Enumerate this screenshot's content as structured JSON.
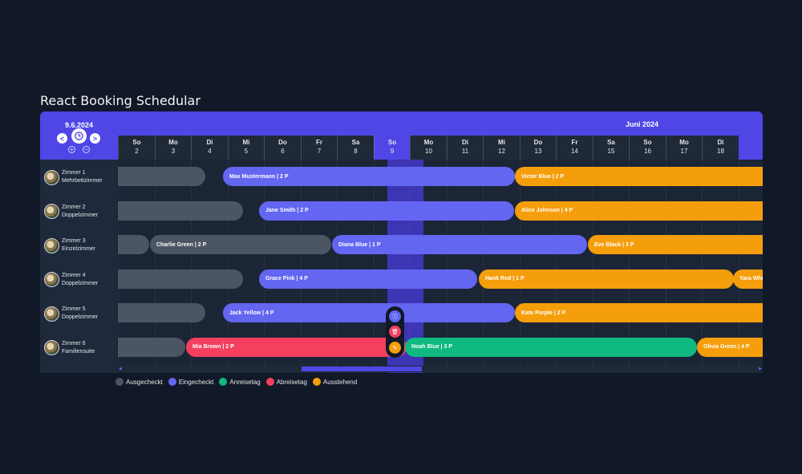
{
  "title": "React Booking Schedular",
  "header": {
    "current_date": "9.6.2024",
    "month": "Juni 2024",
    "prev_label": "<",
    "next_label": ">",
    "zoom_in": "+",
    "zoom_out": "−"
  },
  "colors": {
    "accent": "#4f46e5",
    "ausgecheckt": "#4b5563",
    "eingecheckt": "#6366f1",
    "anreisetag": "#10b981",
    "abreisetag": "#f43f5e",
    "ausstehend": "#f59e0b"
  },
  "days": [
    {
      "name": "So",
      "date": "2"
    },
    {
      "name": "Mo",
      "date": "3"
    },
    {
      "name": "Di",
      "date": "4"
    },
    {
      "name": "Mi",
      "date": "5"
    },
    {
      "name": "Do",
      "date": "6"
    },
    {
      "name": "Fr",
      "date": "7"
    },
    {
      "name": "Sa",
      "date": "8"
    },
    {
      "name": "So",
      "date": "9"
    },
    {
      "name": "Mo",
      "date": "10"
    },
    {
      "name": "Di",
      "date": "11"
    },
    {
      "name": "Mi",
      "date": "12"
    },
    {
      "name": "Do",
      "date": "13"
    },
    {
      "name": "Fr",
      "date": "14"
    },
    {
      "name": "Sa",
      "date": "15"
    },
    {
      "name": "So",
      "date": "16"
    },
    {
      "name": "Mo",
      "date": "17"
    },
    {
      "name": "Di",
      "date": "18"
    }
  ],
  "rooms": [
    {
      "name": "Zimmer 1",
      "type": "Mehrbettzimmer"
    },
    {
      "name": "Zimmer 2",
      "type": "Doppelzimmer"
    },
    {
      "name": "Zimmer 3",
      "type": "Einzelzimmer"
    },
    {
      "name": "Zimmer 4",
      "type": "Doppelzimmer"
    },
    {
      "name": "Zimmer 5",
      "type": "Doppelzimmer"
    },
    {
      "name": "Zimmer 6",
      "type": "Familiensuite"
    }
  ],
  "bookings": [
    {
      "room": 0,
      "label": "",
      "status": "out"
    },
    {
      "room": 0,
      "label": "Max Mustermann | 2 P",
      "status": "in"
    },
    {
      "room": 0,
      "label": "Victor Blue | 2 P",
      "status": "pend"
    },
    {
      "room": 1,
      "label": "",
      "status": "out"
    },
    {
      "room": 1,
      "label": "Jane Smith | 2 P",
      "status": "in"
    },
    {
      "room": 1,
      "label": "Alice Johnson | 4 P",
      "status": "pend"
    },
    {
      "room": 2,
      "label": "",
      "status": "out"
    },
    {
      "room": 2,
      "label": "Charlie Green | 2 P",
      "status": "out"
    },
    {
      "room": 2,
      "label": "Diana Blue | 1 P",
      "status": "in"
    },
    {
      "room": 2,
      "label": "Eve Black | 3 P",
      "status": "pend"
    },
    {
      "room": 3,
      "label": "",
      "status": "out"
    },
    {
      "room": 3,
      "label": "Grace Pink | 4 P",
      "status": "in"
    },
    {
      "room": 3,
      "label": "Hank Red | 1 P",
      "status": "pend"
    },
    {
      "room": 3,
      "label": "Yara White",
      "status": "pend"
    },
    {
      "room": 4,
      "label": "",
      "status": "out"
    },
    {
      "room": 4,
      "label": "Jack Yellow | 4 P",
      "status": "in"
    },
    {
      "room": 4,
      "label": "Kate Purple | 2 P",
      "status": "pend"
    },
    {
      "room": 5,
      "label": "",
      "status": "out"
    },
    {
      "room": 5,
      "label": "Mia Brown | 2 P",
      "status": "dep"
    },
    {
      "room": 5,
      "label": "Noah Blue | 3 P",
      "status": "arr"
    },
    {
      "room": 5,
      "label": "Olivia Green | 4 P",
      "status": "pend"
    }
  ],
  "actions": {
    "info_icon": "ⓘ",
    "delete_icon": "🗑",
    "edit_icon": "✎"
  },
  "legend": [
    {
      "label": "Ausgecheckt",
      "status": "out"
    },
    {
      "label": "Eingecheckt",
      "status": "in"
    },
    {
      "label": "Anreisetag",
      "status": "arr"
    },
    {
      "label": "Abreisetag",
      "status": "dep"
    },
    {
      "label": "Ausstehend",
      "status": "pend"
    }
  ],
  "scroll_position": 0.35
}
